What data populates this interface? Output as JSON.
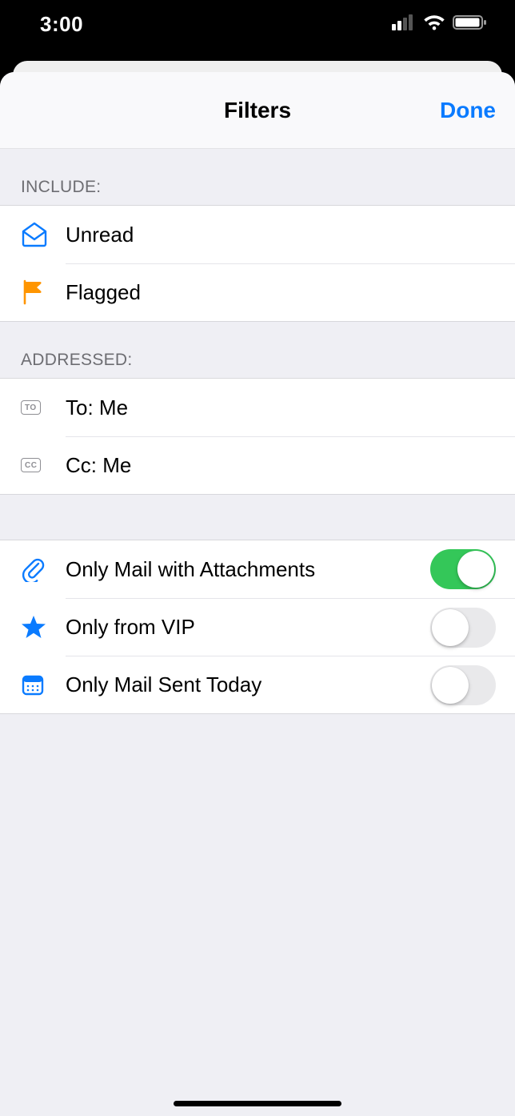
{
  "status": {
    "time": "3:00"
  },
  "nav": {
    "title": "Filters",
    "done": "Done"
  },
  "sections": {
    "include": {
      "header": "INCLUDE:",
      "unread": "Unread",
      "flagged": "Flagged"
    },
    "addressed": {
      "header": "ADDRESSED:",
      "to_badge": "TO",
      "to_label": "To: Me",
      "cc_badge": "CC",
      "cc_label": "Cc: Me"
    },
    "options": {
      "attachments": {
        "label": "Only Mail with Attachments",
        "on": true
      },
      "vip": {
        "label": "Only from VIP",
        "on": false
      },
      "today": {
        "label": "Only Mail Sent Today",
        "on": false
      }
    }
  },
  "colors": {
    "accent": "#0a7bff",
    "flag": "#ff9500",
    "toggle_on": "#34c759",
    "icon_blue": "#0a7bff"
  }
}
